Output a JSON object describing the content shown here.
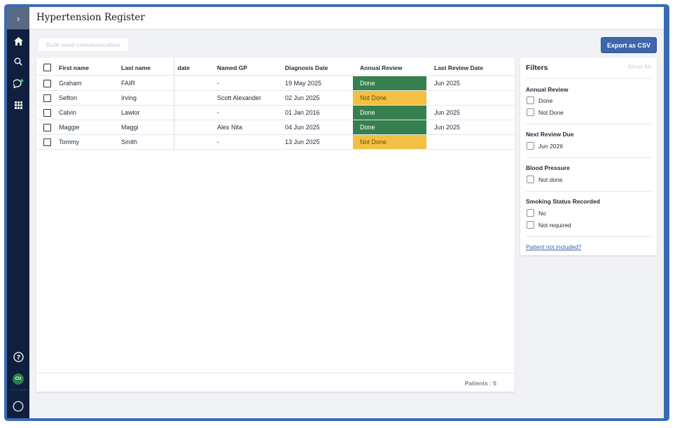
{
  "page": {
    "title": "Hypertension Register"
  },
  "sidebar": {
    "toggle_icon": "chevron-right-icon",
    "items": [
      {
        "name": "home-icon"
      },
      {
        "name": "search-icon"
      },
      {
        "name": "chat-icon"
      },
      {
        "name": "apps-grid-icon"
      }
    ],
    "bottom": {
      "help_icon": "help-icon",
      "avatar_initials": "CU",
      "status_icon": "circle-icon"
    }
  },
  "toolbar": {
    "bulk_label": "Bulk send communication",
    "export_label": "Export as CSV"
  },
  "table": {
    "columns": {
      "first_name": "First name",
      "last_name": "Last name",
      "date": "date",
      "named_gp": "Named GP",
      "diagnosis_date": "Diagnosis Date",
      "annual_review": "Annual Review",
      "last_review_date": "Last Review Date"
    },
    "rows": [
      {
        "first": "Graham",
        "last": "FAIR",
        "gp": "-",
        "diag": "19 May 2025",
        "annual": "Done",
        "last_review": "Jun 2025"
      },
      {
        "first": "Sefton",
        "last": "Irving",
        "gp": "Scott Alexander",
        "diag": "02 Jun 2025",
        "annual": "Not Done",
        "last_review": ""
      },
      {
        "first": "Calvin",
        "last": "Lawlor",
        "gp": "-",
        "diag": "01 Jan 2016",
        "annual": "Done",
        "last_review": "Jun 2025"
      },
      {
        "first": "Maggie",
        "last": "Maggi",
        "gp": "Alex Nita",
        "diag": "04 Jun 2025",
        "annual": "Done",
        "last_review": "Jun 2025"
      },
      {
        "first": "Tommy",
        "last": "Smith",
        "gp": "-",
        "diag": "13 Jun 2025",
        "annual": "Not Done",
        "last_review": ""
      }
    ],
    "footer": "Patients : 5"
  },
  "filters": {
    "title": "Filters",
    "show_all": "Show All",
    "groups": [
      {
        "title": "Annual Review",
        "options": [
          "Done",
          "Not Done"
        ]
      },
      {
        "title": "Next Review Due",
        "options": [
          "Jun 2026"
        ]
      },
      {
        "title": "Blood Pressure",
        "options": [
          "Not done"
        ]
      },
      {
        "title": "Smoking Status Recorded",
        "options": [
          "No",
          "Not required"
        ]
      }
    ],
    "link": "Patient not included?"
  },
  "colors": {
    "done": "#36804f",
    "not_done": "#f2c043",
    "primary": "#3e66a8",
    "sidebar": "#0f1f3d"
  }
}
